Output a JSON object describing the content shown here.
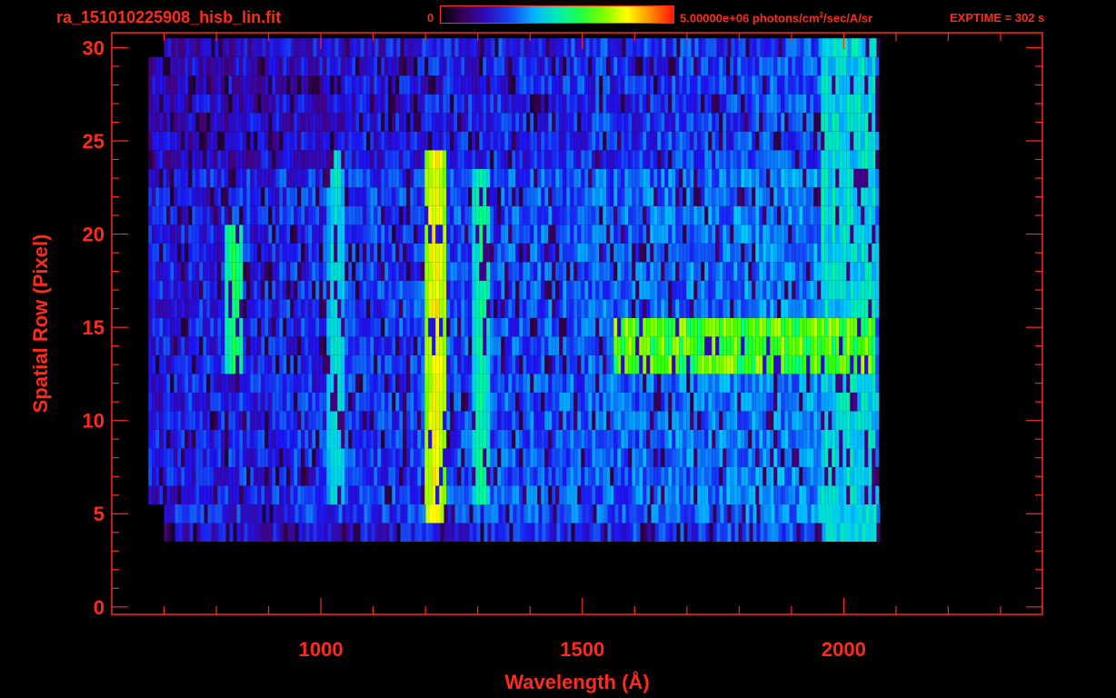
{
  "header": {
    "title": "ra_151010225908_hisb_lin.fit",
    "colorbar_min": "0",
    "colorbar_max_value": "5.00000e+06 photons/cm",
    "colorbar_max_exp": "2",
    "colorbar_max_unit": "/sec/A/sr",
    "exptime": "EXPTIME = 302 s"
  },
  "colors": {
    "axes": "#ff2a1a",
    "background": "#000000"
  },
  "chart_data": {
    "type": "heatmap",
    "title": "ra_151010225908_hisb_lin.fit",
    "xlabel": "Wavelength (Å)",
    "ylabel": "Spatial Row (Pixel)",
    "xlim": [
      600,
      2380
    ],
    "ylim": [
      -0.4,
      30.8
    ],
    "xticks": [
      1000,
      1500,
      2000
    ],
    "yticks": [
      0,
      5,
      10,
      15,
      20,
      25,
      30
    ],
    "colorbar": {
      "min": 0,
      "max": 5000000,
      "unit": "photons/cm^2/sec/A/sr",
      "colormap": "rainbow"
    },
    "rows_with_data": [
      4,
      30
    ],
    "wavelength_coverage": [
      780,
      2060
    ],
    "features": [
      {
        "name": "line-1025",
        "wavelength": 1025,
        "rows": [
          6,
          24
        ],
        "intensity": 0.45
      },
      {
        "name": "line-1216",
        "wavelength": 1216,
        "rows": [
          5,
          24
        ],
        "intensity": 0.78
      },
      {
        "name": "line-1304",
        "wavelength": 1304,
        "rows": [
          6,
          23
        ],
        "intensity": 0.5
      },
      {
        "name": "arc-830",
        "wavelength": 830,
        "rows": [
          13,
          20
        ],
        "intensity": 0.55
      },
      {
        "name": "continuum-row-13",
        "wavelength_range": [
          1560,
          2060
        ],
        "rows": [
          13,
          15
        ],
        "intensity": 0.72
      },
      {
        "name": "red-edge",
        "wavelength_range": [
          1950,
          2060
        ],
        "rows": [
          2,
          30
        ],
        "intensity": 0.5
      }
    ]
  }
}
